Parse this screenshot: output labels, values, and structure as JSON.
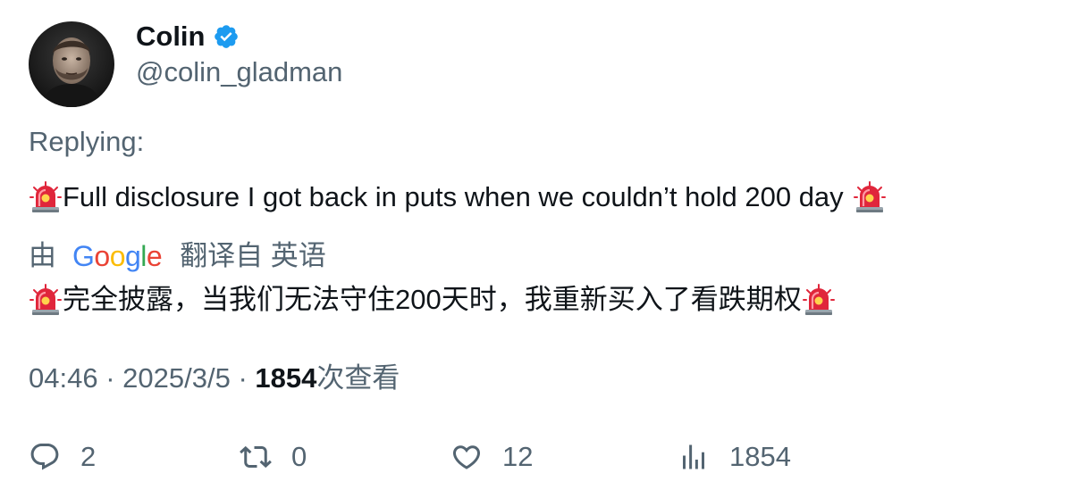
{
  "author": {
    "display_name": "Colin",
    "handle": "@colin_gladman",
    "verified": true
  },
  "replying_label": "Replying:",
  "tweet": {
    "text": "Full disclosure I got back in puts when we couldn’t hold 200 day",
    "leading_emoji": "police-car-light",
    "trailing_emoji": "police-car-light"
  },
  "translation": {
    "prefix": "由",
    "provider": "Google",
    "suffix": "翻译自 英语",
    "text": "完全披露，当我们无法守住200天时，我重新买入了看跌期权"
  },
  "meta": {
    "time": "04:46",
    "separator": "·",
    "date": "2025/3/5",
    "views_count": "1854",
    "views_label": "次查看"
  },
  "actions": {
    "replies": "2",
    "retweets": "0",
    "likes": "12",
    "views": "1854"
  },
  "colors": {
    "text_primary": "#0f1419",
    "text_secondary": "#536471",
    "verified_blue": "#1d9bf0",
    "siren_red": "#e0263b",
    "google_blue": "#4285F4",
    "google_red": "#EA4335",
    "google_yellow": "#FBBC05",
    "google_green": "#34A853"
  }
}
